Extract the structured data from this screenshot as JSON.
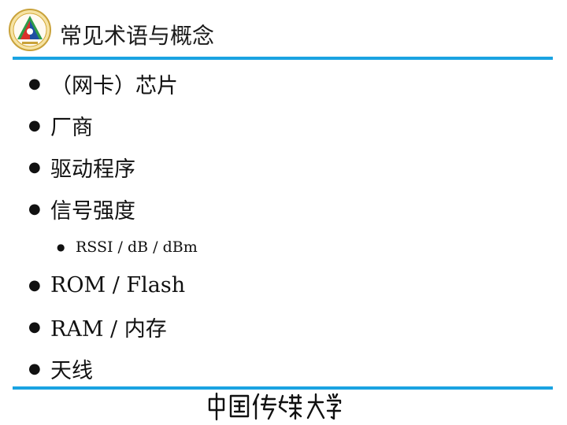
{
  "slide": {
    "title": "常见术语与概念",
    "bullets": [
      {
        "text": "（网卡）芯片"
      },
      {
        "text": "厂商"
      },
      {
        "text": "驱动程序"
      },
      {
        "text": "信号强度"
      }
    ],
    "sub_bullets": [
      {
        "text": "RSSI / dB / dBm"
      }
    ],
    "bullets_after": [
      {
        "text": "ROM / Flash"
      },
      {
        "text": "RAM / 内存"
      },
      {
        "text": "天线"
      }
    ],
    "footer": {
      "signature": "中国传媒大学"
    }
  },
  "colors": {
    "accent_rule": "#1aa3e2",
    "logo_red": "#d9312b",
    "logo_blue": "#1e4fa3",
    "logo_green": "#2e9b48",
    "logo_gold": "#d4a937"
  }
}
